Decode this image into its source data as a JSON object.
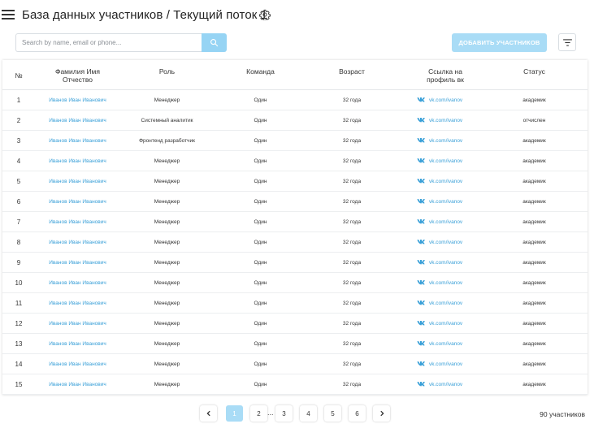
{
  "header": {
    "title": "База данных участников / Текущий поток 1"
  },
  "toolbar": {
    "search_placeholder": "Search by name, email or phone...",
    "search_value": "",
    "add_label": "ДОБАВИТЬ УЧАСТНИКОВ"
  },
  "table": {
    "headers": {
      "num": "№",
      "name_line1": "Фамилия Имя",
      "name_line2": "Отчество",
      "role": "Роль",
      "team": "Команда",
      "age": "Возраст",
      "vk_line1": "Ссылка на",
      "vk_line2": "профиль вк",
      "status": "Статус"
    },
    "rows": [
      {
        "num": "1",
        "name": "Иванов Иван Иванович",
        "role": "Менеджер",
        "team": "Один",
        "age": "32 года",
        "vk": "vk.com/ivanov",
        "status": "академик"
      },
      {
        "num": "2",
        "name": "Иванов Иван Иванович",
        "role": "Системный аналитик",
        "team": "Один",
        "age": "32 года",
        "vk": "vk.com/ivanov",
        "status": "отчислен"
      },
      {
        "num": "3",
        "name": "Иванов Иван Иванович",
        "role": "Фронтенд разработчик",
        "team": "Один",
        "age": "32 года",
        "vk": "vk.com/ivanov",
        "status": "академик"
      },
      {
        "num": "4",
        "name": "Иванов Иван Иванович",
        "role": "Менеджер",
        "team": "Один",
        "age": "32 года",
        "vk": "vk.com/ivanov",
        "status": "академик"
      },
      {
        "num": "5",
        "name": "Иванов Иван Иванович",
        "role": "Менеджер",
        "team": "Один",
        "age": "32 года",
        "vk": "vk.com/ivanov",
        "status": "академик"
      },
      {
        "num": "6",
        "name": "Иванов Иван Иванович",
        "role": "Менеджер",
        "team": "Один",
        "age": "32 года",
        "vk": "vk.com/ivanov",
        "status": "академик"
      },
      {
        "num": "7",
        "name": "Иванов Иван Иванович",
        "role": "Менеджер",
        "team": "Один",
        "age": "32 года",
        "vk": "vk.com/ivanov",
        "status": "академик"
      },
      {
        "num": "8",
        "name": "Иванов Иван Иванович",
        "role": "Менеджер",
        "team": "Один",
        "age": "32 года",
        "vk": "vk.com/ivanov",
        "status": "академик"
      },
      {
        "num": "9",
        "name": "Иванов Иван Иванович",
        "role": "Менеджер",
        "team": "Один",
        "age": "32 года",
        "vk": "vk.com/ivanov",
        "status": "академик"
      },
      {
        "num": "10",
        "name": "Иванов Иван Иванович",
        "role": "Менеджер",
        "team": "Один",
        "age": "32 года",
        "vk": "vk.com/ivanov",
        "status": "академик"
      },
      {
        "num": "11",
        "name": "Иванов Иван Иванович",
        "role": "Менеджер",
        "team": "Один",
        "age": "32 года",
        "vk": "vk.com/ivanov",
        "status": "академик"
      },
      {
        "num": "12",
        "name": "Иванов Иван Иванович",
        "role": "Менеджер",
        "team": "Один",
        "age": "32 года",
        "vk": "vk.com/ivanov",
        "status": "академик"
      },
      {
        "num": "13",
        "name": "Иванов Иван Иванович",
        "role": "Менеджер",
        "team": "Один",
        "age": "32 года",
        "vk": "vk.com/ivanov",
        "status": "академик"
      },
      {
        "num": "14",
        "name": "Иванов Иван Иванович",
        "role": "Менеджер",
        "team": "Один",
        "age": "32 года",
        "vk": "vk.com/ivanov",
        "status": "академик"
      },
      {
        "num": "15",
        "name": "Иванов Иван Иванович",
        "role": "Менеджер",
        "team": "Один",
        "age": "32 года",
        "vk": "vk.com/ivanov",
        "status": "академик"
      }
    ]
  },
  "pagination": {
    "pages": [
      "1",
      "2",
      "3",
      "4",
      "5",
      "6"
    ],
    "current": "1",
    "ellipsis": "...",
    "prev_icon": "chevron-left-icon",
    "next_icon": "chevron-right-icon"
  },
  "footer": {
    "total": "90 участников"
  },
  "colors": {
    "accent": "#a9dcf6",
    "link": "#3aa0d8",
    "vk": "#3aa0d8"
  }
}
